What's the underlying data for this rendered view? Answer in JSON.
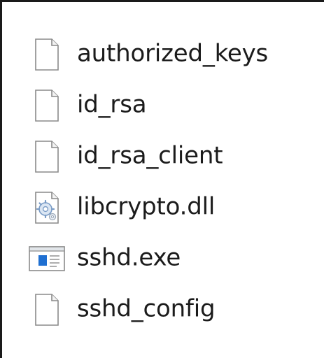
{
  "files": [
    {
      "name": "authorized_keys",
      "icon": "blank-file-icon"
    },
    {
      "name": "id_rsa",
      "icon": "blank-file-icon"
    },
    {
      "name": "id_rsa_client",
      "icon": "blank-file-icon"
    },
    {
      "name": "libcrypto.dll",
      "icon": "dll-file-icon"
    },
    {
      "name": "sshd.exe",
      "icon": "exe-file-icon"
    },
    {
      "name": "sshd_config",
      "icon": "blank-file-icon"
    }
  ],
  "colors": {
    "text": "#1b1b1b",
    "border": "#1a1a1a",
    "file_outline": "#8a8a8a",
    "exe_blue": "#1f6fd1",
    "dll_gear": "#7a9cc6"
  }
}
